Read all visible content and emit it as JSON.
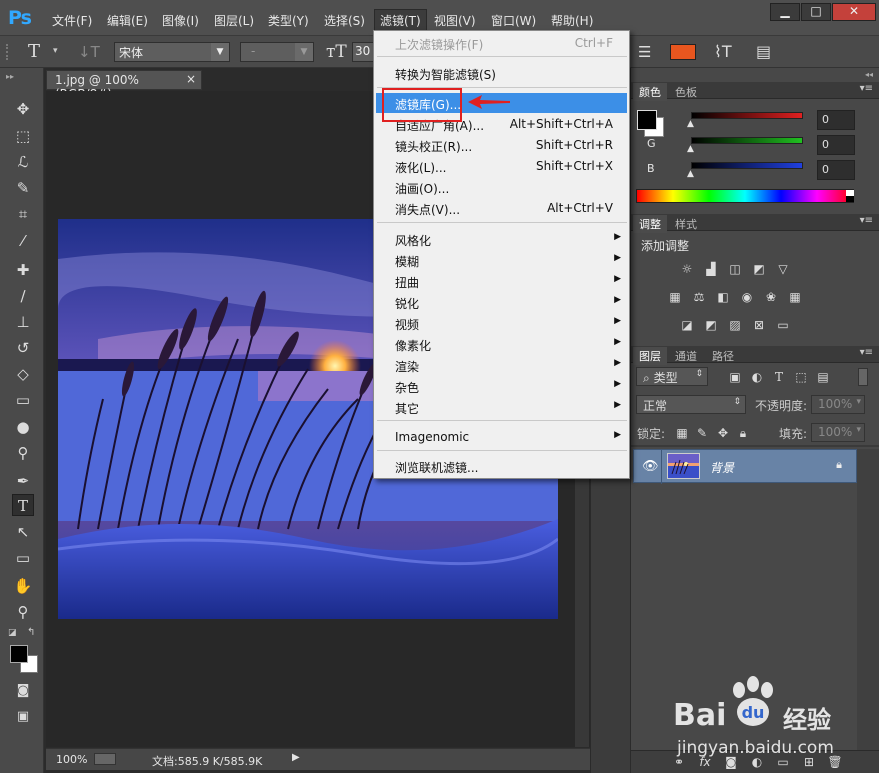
{
  "menubar": {
    "items": [
      "文件(F)",
      "编辑(E)",
      "图像(I)",
      "图层(L)",
      "类型(Y)",
      "选择(S)",
      "滤镜(T)",
      "视图(V)",
      "窗口(W)",
      "帮助(H)"
    ],
    "active_index": 6
  },
  "window_controls": {
    "minimize": "▁",
    "restore": "□",
    "close": "✕"
  },
  "options": {
    "font_family": "宋体",
    "font_style": "-",
    "font_size": "30",
    "text_color": "#e8561f"
  },
  "document": {
    "tab_label": "1.jpg @ 100%(RGB/8#)",
    "tab_close": "×",
    "zoom": "100%",
    "file_info": "文档:585.9 K/585.9K"
  },
  "filter_menu": {
    "items": [
      {
        "label": "上次滤镜操作(F)",
        "shortcut": "Ctrl+F",
        "disabled": true
      },
      {
        "label": "转换为智能滤镜(S)"
      },
      {
        "label": "滤镜库(G)...",
        "highlight": true
      },
      {
        "label": "自适应广角(A)...",
        "shortcut": "Alt+Shift+Ctrl+A"
      },
      {
        "label": "镜头校正(R)...",
        "shortcut": "Shift+Ctrl+R"
      },
      {
        "label": "液化(L)...",
        "shortcut": "Shift+Ctrl+X"
      },
      {
        "label": "油画(O)..."
      },
      {
        "label": "消失点(V)...",
        "shortcut": "Alt+Ctrl+V"
      },
      {
        "label": "风格化",
        "submenu": true
      },
      {
        "label": "模糊",
        "submenu": true
      },
      {
        "label": "扭曲",
        "submenu": true
      },
      {
        "label": "锐化",
        "submenu": true
      },
      {
        "label": "视频",
        "submenu": true
      },
      {
        "label": "像素化",
        "submenu": true
      },
      {
        "label": "渲染",
        "submenu": true
      },
      {
        "label": "杂色",
        "submenu": true
      },
      {
        "label": "其它",
        "submenu": true
      },
      {
        "label": "Imagenomic",
        "submenu": true
      },
      {
        "label": "浏览联机滤镜..."
      }
    ]
  },
  "color_panel": {
    "tabs": [
      "颜色",
      "色板"
    ],
    "rows": [
      {
        "channel": "R",
        "value": "0",
        "color": "#e02020"
      },
      {
        "channel": "G",
        "value": "0",
        "color": "#20c020"
      },
      {
        "channel": "B",
        "value": "0",
        "color": "#2040e0"
      }
    ]
  },
  "adjust_panel": {
    "tabs": [
      "调整",
      "样式"
    ],
    "heading": "添加调整"
  },
  "layers_panel": {
    "tabs": [
      "图层",
      "通道",
      "路径"
    ],
    "kind_label": "类型",
    "blend_mode": "正常",
    "opacity_label": "不透明度:",
    "opacity_value": "100%",
    "lock_label": "锁定:",
    "fill_label": "填充:",
    "fill_value": "100%",
    "layers": [
      {
        "name": "背景"
      }
    ]
  },
  "watermark": {
    "brand": "Bai",
    "brand_suffix": "经验",
    "url": "jingyan.baidu.com"
  }
}
